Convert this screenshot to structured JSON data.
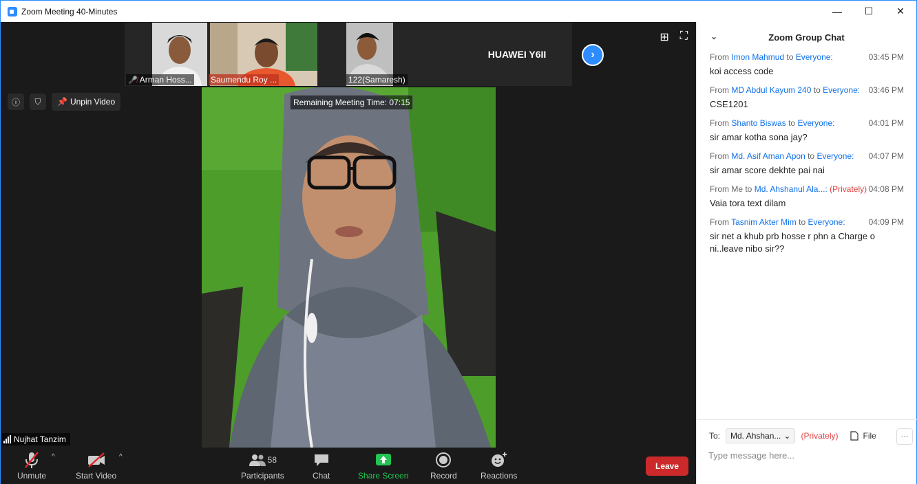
{
  "window": {
    "title": "Zoom Meeting 40-Minutes",
    "controls": [
      "—",
      "☐",
      "✕"
    ]
  },
  "thumbnails": [
    {
      "name": "Arman Hoss...",
      "muted": true
    },
    {
      "name": "Saumendu Roy ..."
    },
    {
      "name": "122(Samaresh)"
    },
    {
      "name": "HUAWEI Y6II"
    }
  ],
  "overlay": {
    "unpin_label": "Unpin Video",
    "timer": "Remaining Meeting Time: 07:15",
    "speaker_name": "Nujhat Tanzim"
  },
  "toolbar": {
    "unmute": "Unmute",
    "start_video": "Start Video",
    "participants": "Participants",
    "participants_count": "58",
    "chat": "Chat",
    "share_screen": "Share Screen",
    "record": "Record",
    "reactions": "Reactions",
    "leave": "Leave"
  },
  "chat": {
    "title": "Zoom Group Chat",
    "messages": [
      {
        "prefix": "From",
        "sender": "Imon Mahmud",
        "to_word": "to",
        "recipient": "Everyone:",
        "private": "",
        "time": "03:45 PM",
        "text": "koi access code"
      },
      {
        "prefix": "From",
        "sender": "MD Abdul Kayum 240",
        "to_word": "to",
        "recipient": "Everyone:",
        "private": "",
        "time": "03:46 PM",
        "text": "CSE1201"
      },
      {
        "prefix": "From",
        "sender": "Shanto Biswas",
        "to_word": "to",
        "recipient": "Everyone:",
        "private": "",
        "time": "04:01 PM",
        "text": "sir amar kotha sona jay?"
      },
      {
        "prefix": "From",
        "sender": "Md. Asif Aman Apon",
        "to_word": "to",
        "recipient": "Everyone:",
        "private": "",
        "time": "04:07 PM",
        "text": "sir amar score dekhte pai nai"
      },
      {
        "prefix": "From Me",
        "sender": "",
        "to_word": "to",
        "recipient": "Md. Ahshanul Ala...:",
        "private": "(Privately)",
        "time": "04:08 PM",
        "text": "Vaia tora text dilam"
      },
      {
        "prefix": "From",
        "sender": "Tasnim Akter Mim",
        "to_word": "to",
        "recipient": "Everyone:",
        "private": "",
        "time": "04:09 PM",
        "text": "sir net a khub prb hosse r phn a Charge o ni..leave nibo sir??"
      }
    ],
    "footer": {
      "to_label": "To:",
      "to_value": "Md. Ahshan...",
      "privately": "(Privately)",
      "file_label": "File",
      "more": "···",
      "placeholder": "Type message here..."
    }
  },
  "colors": {
    "accent": "#2d8cff",
    "leave": "#cc2a2a",
    "share": "#23c552",
    "private": "#e04040"
  }
}
